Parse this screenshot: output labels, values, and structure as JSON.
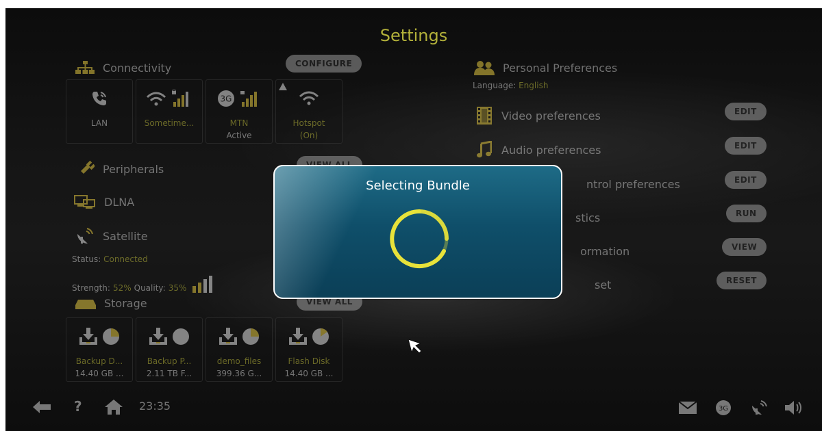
{
  "screen": {
    "title": "Settings"
  },
  "connectivity": {
    "label": "Connectivity",
    "configure_label": "CONFIGURE",
    "tiles": [
      {
        "line1": "LAN",
        "line2": ""
      },
      {
        "line1": "Sometime...",
        "line2": ""
      },
      {
        "badge": "3G",
        "line1": "MTN",
        "line2": "Active"
      },
      {
        "line1": "Hotspot",
        "line2": "(On)"
      }
    ]
  },
  "peripherals": {
    "label": "Peripherals",
    "view_all_label": "VIEW ALL"
  },
  "dlna": {
    "label": "DLNA"
  },
  "satellite": {
    "label": "Satellite",
    "status_label": "Status:",
    "status_value": "Connected",
    "strength_label": "Strength:",
    "strength_value": "52%",
    "quality_label": "Quality:",
    "quality_value": "35%"
  },
  "storage": {
    "label": "Storage",
    "view_all_label": "VIEW ALL",
    "tiles": [
      {
        "line1": "Backup D...",
        "line2": "14.40 GB ...",
        "used": 0.25
      },
      {
        "line1": "Backup P...",
        "line2": "2.11 TB F...",
        "used": 0.0
      },
      {
        "line1": "demo_files",
        "line2": "399.36 G...",
        "used": 0.25
      },
      {
        "line1": "Flash Disk",
        "line2": "14.40 GB ...",
        "used": 0.15
      }
    ]
  },
  "personal": {
    "label": "Personal Preferences",
    "language_label": "Language:",
    "language_value": "English"
  },
  "prefs": [
    {
      "label": "Video preferences",
      "action": "EDIT"
    },
    {
      "label": "Audio preferences",
      "action": "EDIT"
    },
    {
      "label": "ntrol preferences",
      "action": "EDIT"
    },
    {
      "label": "stics",
      "action": "RUN"
    },
    {
      "label": "ormation",
      "action": "VIEW"
    },
    {
      "label": "set",
      "action": "RESET"
    }
  ],
  "modal": {
    "title": "Selecting Bundle"
  },
  "status_bar": {
    "clock": "23:35",
    "help": "?",
    "badge_3g": "3G"
  },
  "colors": {
    "accent": "#b3b13a",
    "modal_bg": "#0f4f6a",
    "spinner": "#e8e23a"
  }
}
